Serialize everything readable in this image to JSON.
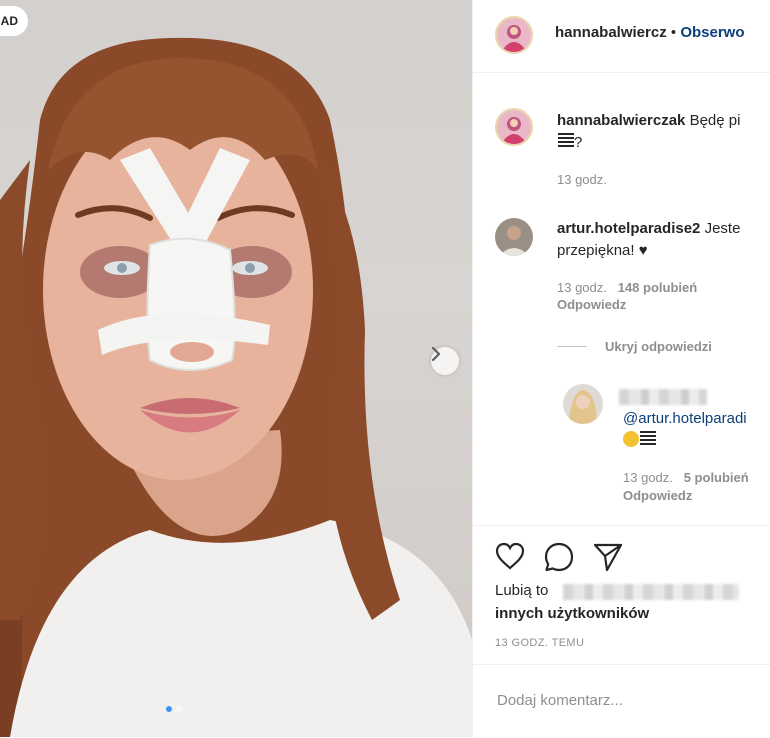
{
  "photo": {
    "badge": "AD",
    "next_icon": "chevron-right-icon",
    "carousel": {
      "count": 2,
      "active": 1
    }
  },
  "header": {
    "username": "hannabalwiercz",
    "separator": "•",
    "follow_label": "Obserwo"
  },
  "caption": {
    "username": "hannabalwierczak",
    "text": "Będę pi",
    "text_line2": "?",
    "time": "13 godz."
  },
  "comments": [
    {
      "username": "artur.hotelparadise2",
      "text_inline": "Jeste",
      "text_line2": "przepiękna! ♥",
      "time": "13 godz.",
      "likes": "148 polubień",
      "reply_label": "Odpowiedz",
      "hide_replies_label": "Ukryj odpowiedzi",
      "replies": [
        {
          "mention": "@artur.hotelparadi",
          "time": "13 godz.",
          "likes": "5 polubień",
          "reply_label": "Odpowiedz"
        }
      ]
    }
  ],
  "actions": {
    "like_icon": "heart-icon",
    "comment_icon": "comment-icon",
    "share_icon": "share-icon"
  },
  "likes": {
    "prefix": "Lubią to",
    "suffix": "innych użytkowników"
  },
  "timestamp": "13 GODZ. TEMU",
  "add_comment": {
    "placeholder": "Dodaj komentarz..."
  }
}
